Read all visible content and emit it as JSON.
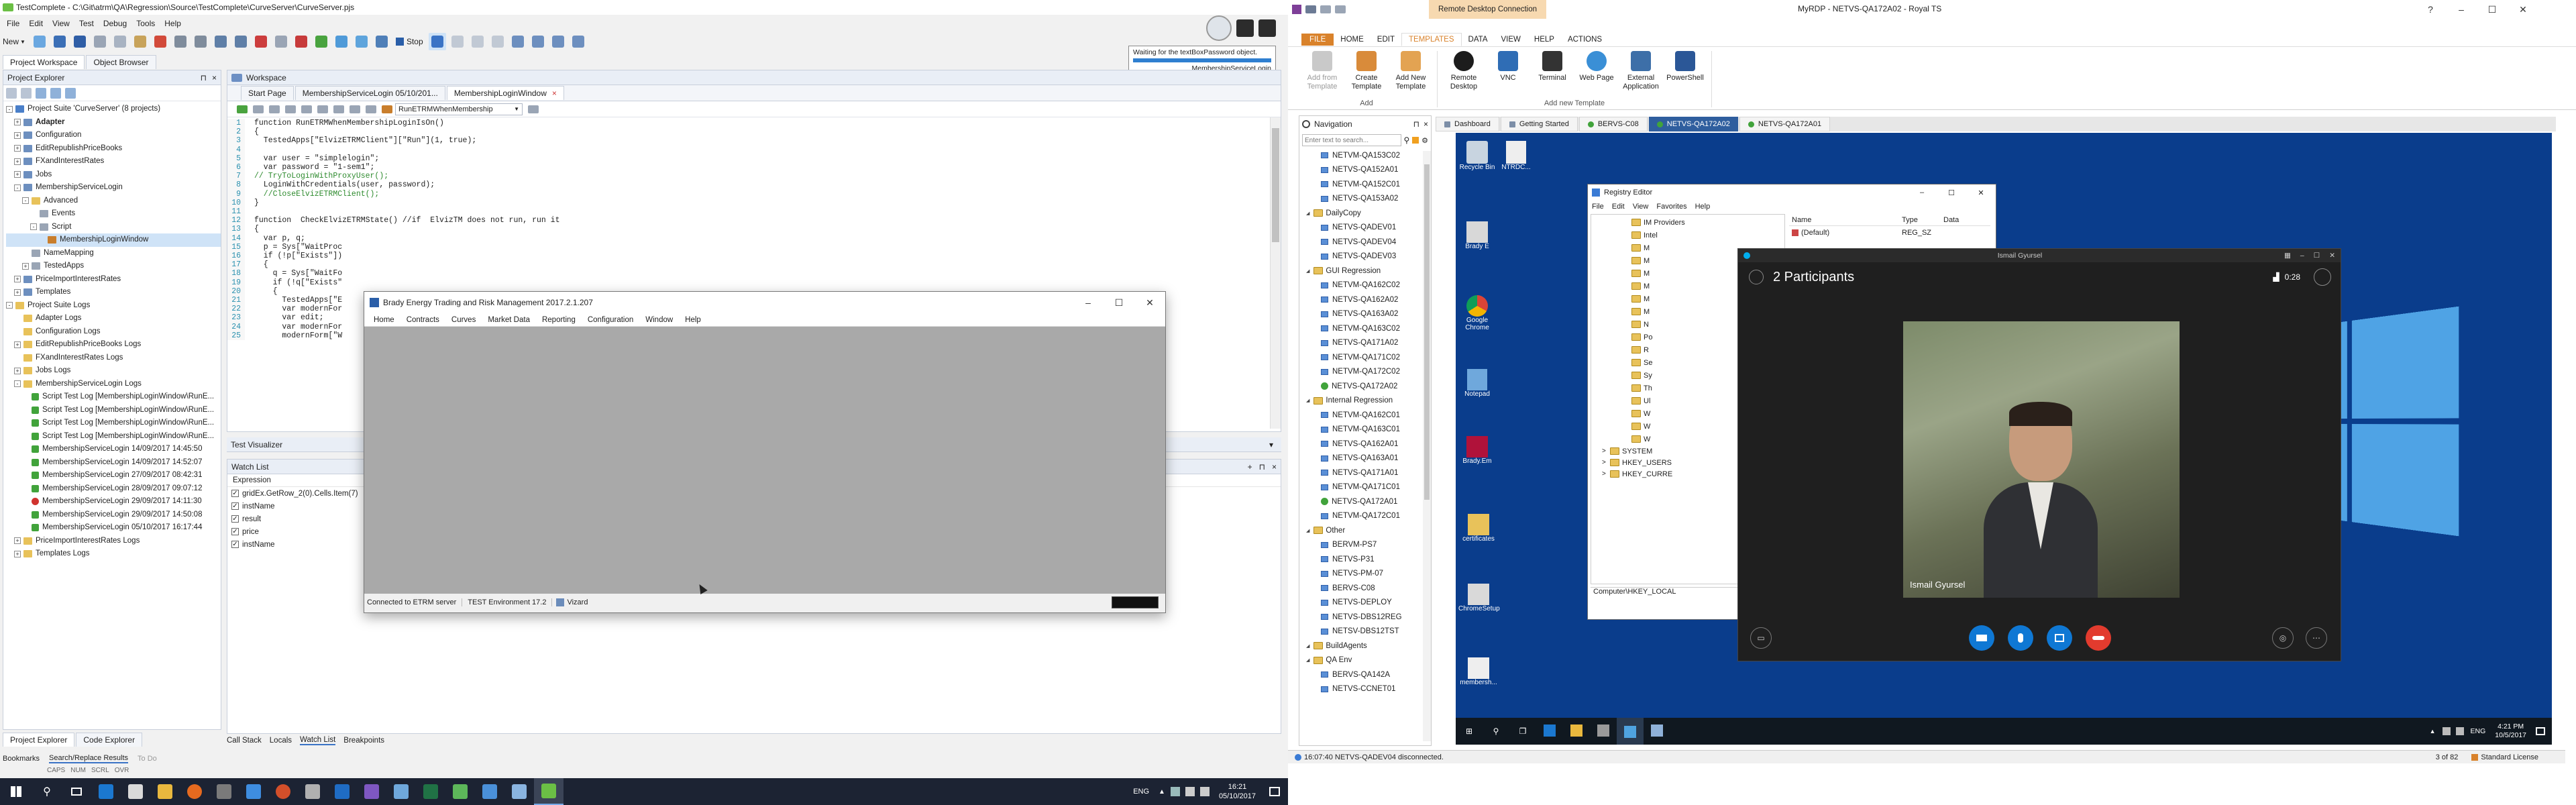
{
  "tc": {
    "title": "TestComplete - C:\\Git\\atrm\\QA\\Regression\\Source\\TestComplete\\CurveServer\\CurveServer.pjs",
    "menu": [
      "File",
      "Edit",
      "View",
      "Test",
      "Debug",
      "Tools",
      "Help"
    ],
    "toolbar_new": "New",
    "toolbar_stop": "Stop",
    "panel_tabs": [
      "Project Workspace",
      "Object Browser"
    ],
    "project_explorer_title": "Project Explorer",
    "project_tree": [
      {
        "label": "Project Suite 'CurveServer' (8 projects)",
        "level": 0,
        "exp": "-",
        "icon": "suite",
        "bold": false
      },
      {
        "label": "Adapter",
        "level": 1,
        "exp": "+",
        "icon": "proj",
        "bold": true
      },
      {
        "label": "Configuration",
        "level": 1,
        "exp": "+",
        "icon": "proj",
        "bold": false
      },
      {
        "label": "EditRepublishPriceBooks",
        "level": 1,
        "exp": "+",
        "icon": "proj",
        "bold": false
      },
      {
        "label": "FXandInterestRates",
        "level": 1,
        "exp": "+",
        "icon": "proj",
        "bold": false
      },
      {
        "label": "Jobs",
        "level": 1,
        "exp": "+",
        "icon": "proj",
        "bold": false
      },
      {
        "label": "MembershipServiceLogin",
        "level": 1,
        "exp": "-",
        "icon": "proj",
        "bold": false
      },
      {
        "label": "Advanced",
        "level": 2,
        "exp": "-",
        "icon": "folder",
        "bold": false
      },
      {
        "label": "Events",
        "level": 3,
        "exp": "",
        "icon": "item",
        "bold": false
      },
      {
        "label": "Script",
        "level": 3,
        "exp": "-",
        "icon": "item",
        "bold": false
      },
      {
        "label": "MembershipLoginWindow",
        "level": 4,
        "exp": "",
        "icon": "script",
        "bold": false,
        "selected": true
      },
      {
        "label": "NameMapping",
        "level": 2,
        "exp": "",
        "icon": "item",
        "bold": false
      },
      {
        "label": "TestedApps",
        "level": 2,
        "exp": "+",
        "icon": "item",
        "bold": false
      },
      {
        "label": "PriceImportInterestRates",
        "level": 1,
        "exp": "+",
        "icon": "proj",
        "bold": false
      },
      {
        "label": "Templates",
        "level": 1,
        "exp": "+",
        "icon": "proj",
        "bold": false
      },
      {
        "label": "Project Suite Logs",
        "level": 0,
        "exp": "-",
        "icon": "folder",
        "bold": false
      },
      {
        "label": "Adapter Logs",
        "level": 1,
        "exp": "",
        "icon": "folder",
        "bold": false
      },
      {
        "label": "Configuration Logs",
        "level": 1,
        "exp": "",
        "icon": "folder",
        "bold": false
      },
      {
        "label": "EditRepublishPriceBooks Logs",
        "level": 1,
        "exp": "+",
        "icon": "folder",
        "bold": false
      },
      {
        "label": "FXandInterestRates Logs",
        "level": 1,
        "exp": "",
        "icon": "folder",
        "bold": false
      },
      {
        "label": "Jobs Logs",
        "level": 1,
        "exp": "+",
        "icon": "folder",
        "bold": false
      },
      {
        "label": "MembershipServiceLogin Logs",
        "level": 1,
        "exp": "-",
        "icon": "folder",
        "bold": false
      },
      {
        "label": "Script Test Log [MembershipLoginWindow\\RunE...",
        "level": 2,
        "exp": "",
        "icon": "ok",
        "bold": false
      },
      {
        "label": "Script Test Log [MembershipLoginWindow\\RunE...",
        "level": 2,
        "exp": "",
        "icon": "ok",
        "bold": false
      },
      {
        "label": "Script Test Log [MembershipLoginWindow\\RunE...",
        "level": 2,
        "exp": "",
        "icon": "ok",
        "bold": false
      },
      {
        "label": "Script Test Log [MembershipLoginWindow\\RunE...",
        "level": 2,
        "exp": "",
        "icon": "ok",
        "bold": false
      },
      {
        "label": "MembershipServiceLogin 14/09/2017 14:45:50",
        "level": 2,
        "exp": "",
        "icon": "ok",
        "bold": false
      },
      {
        "label": "MembershipServiceLogin 14/09/2017 14:52:07",
        "level": 2,
        "exp": "",
        "icon": "ok",
        "bold": false
      },
      {
        "label": "MembershipServiceLogin 27/09/2017 08:42:31",
        "level": 2,
        "exp": "",
        "icon": "ok",
        "bold": false
      },
      {
        "label": "MembershipServiceLogin 28/09/2017 09:07:12",
        "level": 2,
        "exp": "",
        "icon": "ok",
        "bold": false
      },
      {
        "label": "MembershipServiceLogin 29/09/2017 14:11:30",
        "level": 2,
        "exp": "",
        "icon": "err",
        "bold": false
      },
      {
        "label": "MembershipServiceLogin 29/09/2017 14:50:08",
        "level": 2,
        "exp": "",
        "icon": "ok",
        "bold": false
      },
      {
        "label": "MembershipServiceLogin 05/10/2017 16:17:44",
        "level": 2,
        "exp": "",
        "icon": "ok",
        "bold": false
      },
      {
        "label": "PriceImportInterestRates Logs",
        "level": 1,
        "exp": "+",
        "icon": "folder",
        "bold": false
      },
      {
        "label": "Templates Logs",
        "level": 1,
        "exp": "+",
        "icon": "folder",
        "bold": false
      }
    ],
    "left_bottom_tabs": [
      "Project Explorer",
      "Code Explorer"
    ],
    "workspace_title": "Workspace",
    "editor_tabs": [
      "Start Page",
      "MembershipServiceLogin 05/10/201...",
      "MembershipLoginWindow"
    ],
    "routine_combo": "RunETRMWhenMembership",
    "code_lines": [
      "function RunETRMWhenMembershipLoginIsOn()",
      "{",
      "  TestedApps[\"ElvizETRMClient\"][\"Run\"](1, true);",
      "",
      "  var user = \"simplelogin\";",
      "  var password = \"1-sem1\";",
      "// TryToLoginWithProxyUser();",
      "  LoginWithCredentials(user, password);",
      "  //CloseElvizETRMClient();",
      "}",
      "",
      "function  CheckElvizETRMState() //if  ElvizTM does not run, run it",
      "{",
      "  var p, q;",
      "  p = Sys[\"WaitProc",
      "  if (!p[\"Exists\"])",
      "  {",
      "    q = Sys[\"WaitFo",
      "    if (!q[\"Exists\"",
      "    {",
      "      TestedApps[\"E",
      "      var modernFor",
      "      var edit;",
      "      var modernFor",
      "      modernForm[\"W"
    ],
    "test_visualizer": "Test Visualizer",
    "watch_list_title": "Watch List",
    "watch_header": "Expression",
    "watch_items": [
      "gridEx.GetRow_2(0).Cells.Item(7)",
      "instName",
      "result",
      "price",
      "instName"
    ],
    "bottom_tabs": [
      "Call Stack",
      "Locals",
      "Watch List",
      "Breakpoints"
    ],
    "status_tabs": [
      "Bookmarks",
      "Search/Replace Results",
      "To Do"
    ],
    "status_keys": [
      "CAPS",
      "NUM",
      "SCRL",
      "OVR"
    ],
    "notify_text": "Waiting for the textBoxPassword object.",
    "notify_sub": "MembershipServiceLogin"
  },
  "brady": {
    "title": "Brady Energy Trading and Risk Management 2017.2.1.207",
    "menu": [
      "Home",
      "Contracts",
      "Curves",
      "Market Data",
      "Reporting",
      "Configuration",
      "Window",
      "Help"
    ],
    "status": [
      "Connected to ETRM server",
      "TEST Environment 17.2",
      "Vizard"
    ]
  },
  "taskbar_left": {
    "lang": "ENG",
    "time": "16:21",
    "date": "05/10/2017"
  },
  "royalts": {
    "title": "MyRDP - NETVS-QA172A02 - Royal TS",
    "context_tab": "Remote Desktop Connection",
    "ribbon_tabs": [
      "FILE",
      "HOME",
      "EDIT",
      "TEMPLATES",
      "DATA",
      "VIEW",
      "HELP",
      "ACTIONS"
    ],
    "ribbon_active": "TEMPLATES",
    "ribbon_add": [
      "Add from Template",
      "Create Template",
      "Add New Template"
    ],
    "ribbon_new": [
      "Remote Desktop",
      "VNC",
      "Terminal",
      "Web Page",
      "External Application",
      "PowerShell"
    ],
    "group_add": "Add",
    "group_new": "Add new Template",
    "nav_title": "Navigation",
    "nav_search_placeholder": "Enter text to search...",
    "doc_tabs": [
      "Dashboard",
      "Getting Started",
      "BERVS-C08",
      "NETVS-QA172A02",
      "NETVS-QA172A01"
    ],
    "doc_tab_active": 3,
    "nav_items": [
      {
        "label": "NETVM-QA153C02",
        "type": "pc",
        "level": 2
      },
      {
        "label": "NETVS-QA152A01",
        "type": "pc",
        "level": 2
      },
      {
        "label": "NETVM-QA152C01",
        "type": "pc",
        "level": 2
      },
      {
        "label": "NETVS-QA153A02",
        "type": "pc",
        "level": 2
      },
      {
        "label": "DailyCopy",
        "type": "folder",
        "level": 1
      },
      {
        "label": "NETVS-QADEV01",
        "type": "pc",
        "level": 2
      },
      {
        "label": "NETVS-QADEV04",
        "type": "pc",
        "level": 2
      },
      {
        "label": "NETVS-QADEV03",
        "type": "pc",
        "level": 2
      },
      {
        "label": "GUI Regression",
        "type": "folder",
        "level": 1
      },
      {
        "label": "NETVM-QA162C02",
        "type": "pc",
        "level": 2
      },
      {
        "label": "NETVS-QA162A02",
        "type": "pc",
        "level": 2
      },
      {
        "label": "NETVS-QA163A02",
        "type": "pc",
        "level": 2
      },
      {
        "label": "NETVM-QA163C02",
        "type": "pc",
        "level": 2
      },
      {
        "label": "NETVS-QA171A02",
        "type": "pc",
        "level": 2
      },
      {
        "label": "NETVM-QA171C02",
        "type": "pc",
        "level": 2
      },
      {
        "label": "NETVM-QA172C02",
        "type": "pc",
        "level": 2
      },
      {
        "label": "NETVS-QA172A02",
        "type": "ok",
        "level": 2
      },
      {
        "label": "Internal Regression",
        "type": "folder",
        "level": 1
      },
      {
        "label": "NETVM-QA162C01",
        "type": "pc",
        "level": 2
      },
      {
        "label": "NETVM-QA163C01",
        "type": "pc",
        "level": 2
      },
      {
        "label": "NETVS-QA162A01",
        "type": "pc",
        "level": 2
      },
      {
        "label": "NETVS-QA163A01",
        "type": "pc",
        "level": 2
      },
      {
        "label": "NETVS-QA171A01",
        "type": "pc",
        "level": 2
      },
      {
        "label": "NETVM-QA171C01",
        "type": "pc",
        "level": 2
      },
      {
        "label": "NETVS-QA172A01",
        "type": "ok",
        "level": 2
      },
      {
        "label": "NETVM-QA172C01",
        "type": "pc",
        "level": 2
      },
      {
        "label": "Other",
        "type": "folder",
        "level": 1
      },
      {
        "label": "BERVM-PS7",
        "type": "pc",
        "level": 2
      },
      {
        "label": "NETVS-P31",
        "type": "pc",
        "level": 2
      },
      {
        "label": "NETVS-PM-07",
        "type": "pc",
        "level": 2
      },
      {
        "label": "BERVS-C08",
        "type": "pc",
        "level": 2
      },
      {
        "label": "NETVS-DEPLOY",
        "type": "pc",
        "level": 2
      },
      {
        "label": "NETVS-DBS12REG",
        "type": "pc",
        "level": 2
      },
      {
        "label": "NETSV-DBS12TST",
        "type": "pc",
        "level": 2
      },
      {
        "label": "BuildAgents",
        "type": "folder",
        "level": 1
      },
      {
        "label": "QA Env",
        "type": "folder",
        "level": 1
      },
      {
        "label": "BERVS-QA142A",
        "type": "pc",
        "level": 2
      },
      {
        "label": "NETVS-CCNET01",
        "type": "pc",
        "level": 2
      }
    ],
    "status_msg": "16:07:40 NETVS-QADEV04 disconnected.",
    "status_page": "3 of 82",
    "status_license": "Standard License"
  },
  "remote": {
    "desktop_icons": [
      "Recycle Bin",
      "NTRDC...",
      "Brady E",
      "Google Chrome",
      "Notepad",
      "Brady.Em",
      "certificates",
      "ChromeSetup",
      "membersh..."
    ],
    "registry": {
      "title": "Registry Editor",
      "menu": [
        "File",
        "Edit",
        "View",
        "Favorites",
        "Help"
      ],
      "cols": [
        "Name",
        "Type",
        "Data"
      ],
      "row_name": "(Default)",
      "row_type": "REG_SZ",
      "tree_items": [
        "IM Providers",
        "Intel",
        "M",
        "M",
        "M",
        "M",
        "M",
        "M",
        "N",
        "Po",
        "R",
        "Se",
        "Sy",
        "Th",
        "Ul",
        "W",
        "W",
        "W"
      ],
      "tree_bottom": [
        "SYSTEM",
        "HKEY_USERS",
        "HKEY_CURRE"
      ],
      "path": "Computer\\HKEY_LOCAL"
    },
    "call": {
      "title": "Ismail Gyursel",
      "participants": "2 Participants",
      "timer": "0:28",
      "name_tag": "Ismail Gyursel"
    },
    "taskbar": {
      "lang": "ENG",
      "time": "4:21 PM",
      "date": "10/5/2017"
    }
  },
  "colors": {
    "accent_orange": "#d9822b",
    "win10_blue": "#0a3d8c",
    "call_bg": "#1f1f1f",
    "hangup_red": "#e23b2e"
  }
}
